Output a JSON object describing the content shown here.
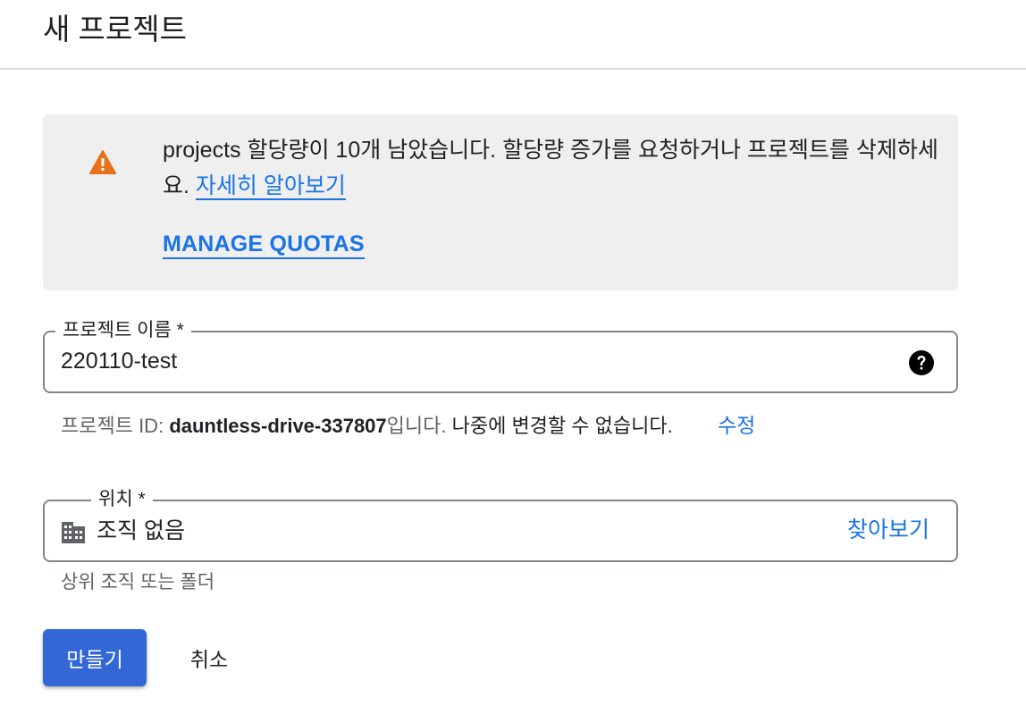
{
  "page": {
    "title": "새 프로젝트"
  },
  "alert": {
    "icon": "warning-icon",
    "message": "projects 할당량이 10개 남았습니다. 할당량 증가를 요청하거나 프로젝트를 삭제하세요.",
    "learn_more": "자세히 알아보기",
    "manage_quotas": "MANAGE QUOTAS",
    "icon_color": "#e8711a"
  },
  "project_name": {
    "label": "프로젝트 이름 *",
    "value": "220110-test",
    "help_icon": "help-circle-icon"
  },
  "project_id": {
    "prefix": "프로젝트 ID: ",
    "id": "dauntless-drive-337807",
    "suffix_gray": "입니다.",
    "suffix": " 나중에 변경할 수 없습니다.",
    "edit_label": "수정"
  },
  "location": {
    "label": "위치 *",
    "value": "조직 없음",
    "icon": "organization-building-icon",
    "browse_label": "찾아보기",
    "helper": "상위 조직 또는 폴더"
  },
  "actions": {
    "create": "만들기",
    "cancel": "취소"
  },
  "colors": {
    "accent": "#1a73e8",
    "primary_button": "#3367d6",
    "alert_background": "#efefef"
  }
}
